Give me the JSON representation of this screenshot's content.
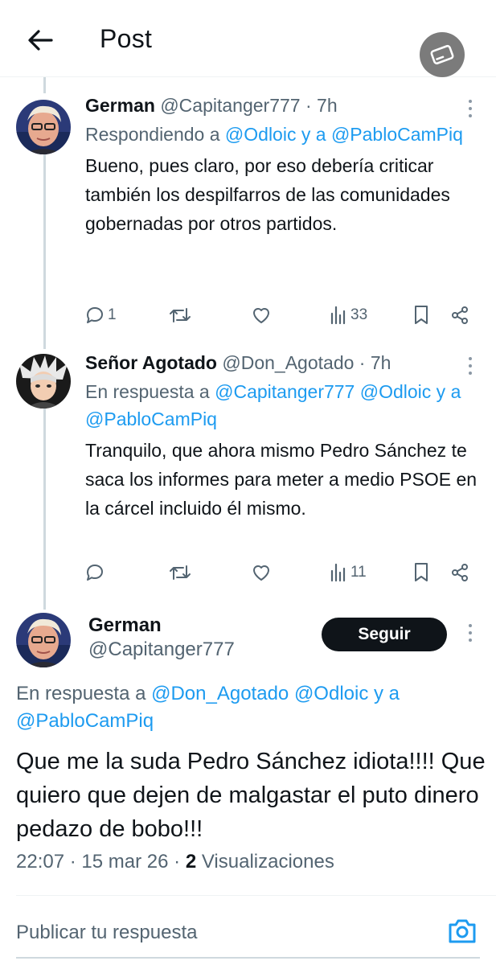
{
  "header": {
    "title": "Post"
  },
  "tweets": [
    {
      "name": "German",
      "handle": "@Capitanger777",
      "dot": "·",
      "time": "7h",
      "reply_prefix": "Respondiendo a ",
      "reply_mentions": [
        "@Odloic",
        "@PabloCamPiq"
      ],
      "reply_joiner": " y a ",
      "text": "Bueno, pues claro, por eso debería criticar también los despilfarros de las comunidades gobernadas por otros partidos.",
      "replies": "1",
      "retweets": "",
      "likes": "",
      "views": "33"
    },
    {
      "name": "Señor Agotado",
      "handle": "@Don_Agotado",
      "dot": "·",
      "time": "7h",
      "reply_prefix": "En respuesta a ",
      "reply_mentions": [
        "@Capitanger777",
        "@Odloic",
        "@PabloCamPiq"
      ],
      "reply_joiner": " y a ",
      "text": "Tranquilo, que ahora mismo Pedro Sánchez te saca los informes para meter a medio PSOE en la cárcel incluido él mismo.",
      "replies": "",
      "retweets": "",
      "likes": "",
      "views": "11"
    }
  ],
  "main": {
    "name": "German",
    "handle": "@Capitanger777",
    "follow_label": "Seguir",
    "reply_prefix": "En respuesta a ",
    "reply_mentions": [
      "@Don_Agotado",
      "@Odloic",
      "@PabloCamPiq"
    ],
    "reply_joiner": " y a ",
    "text": "Que me la suda Pedro Sánchez idiota!!!! Que quiero que dejen de malgastar el puto dinero pedazo de bobo!!!",
    "time": "22:07",
    "dot1": "·",
    "date": "15 mar 26",
    "dot2": "·",
    "views_count": "2",
    "views_label": "Visualizaciones"
  },
  "composer": {
    "placeholder": "Publicar tu respuesta"
  },
  "colors": {
    "accent": "#1d9bf0",
    "text": "#0f1419",
    "muted": "#536471",
    "button": "#0f1419"
  },
  "icons": [
    "back-arrow-icon",
    "card-icon",
    "more-icon",
    "reply-icon",
    "retweet-icon",
    "like-icon",
    "views-icon",
    "bookmark-icon",
    "share-icon",
    "camera-icon"
  ]
}
